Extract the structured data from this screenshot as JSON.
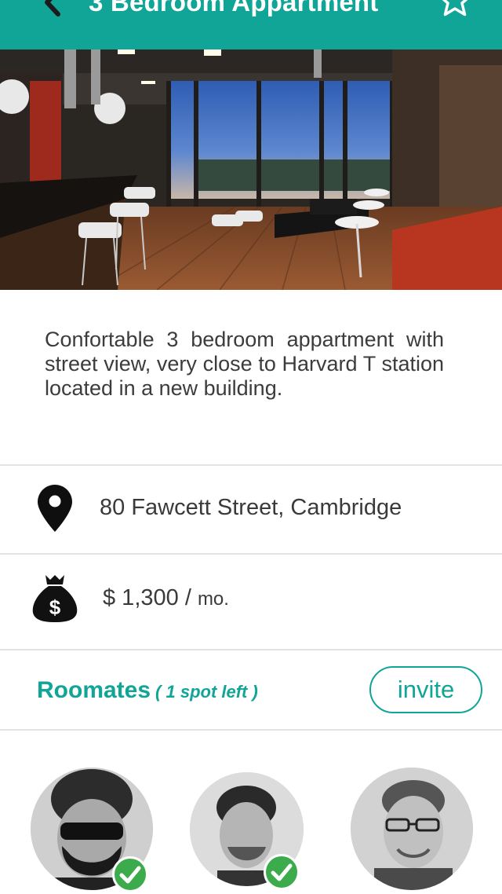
{
  "header": {
    "title": "3 Bedroom Appartment",
    "color": "#11a597"
  },
  "hero": {
    "image_alt": "Apartment interior with kitchen bar and city view"
  },
  "description": "Confortable 3 bedroom appartment with street view, very close to Harvard T station located in a new building.",
  "address": {
    "text": "80 Fawcett Street, Cambridge",
    "icon": "location-pin-icon"
  },
  "price": {
    "amount": "$ 1,300",
    "separator": " / ",
    "unit": "mo.",
    "icon": "money-bag-icon"
  },
  "roommates": {
    "title": "Roomates",
    "spots": "( 1 spot left )",
    "invite_label": "invite",
    "members": [
      {
        "confirmed": true
      },
      {
        "confirmed": true
      },
      {
        "confirmed": false
      }
    ]
  },
  "colors": {
    "accent": "#11a597",
    "check": "#3bab4b",
    "divider": "#e3e3e3"
  }
}
